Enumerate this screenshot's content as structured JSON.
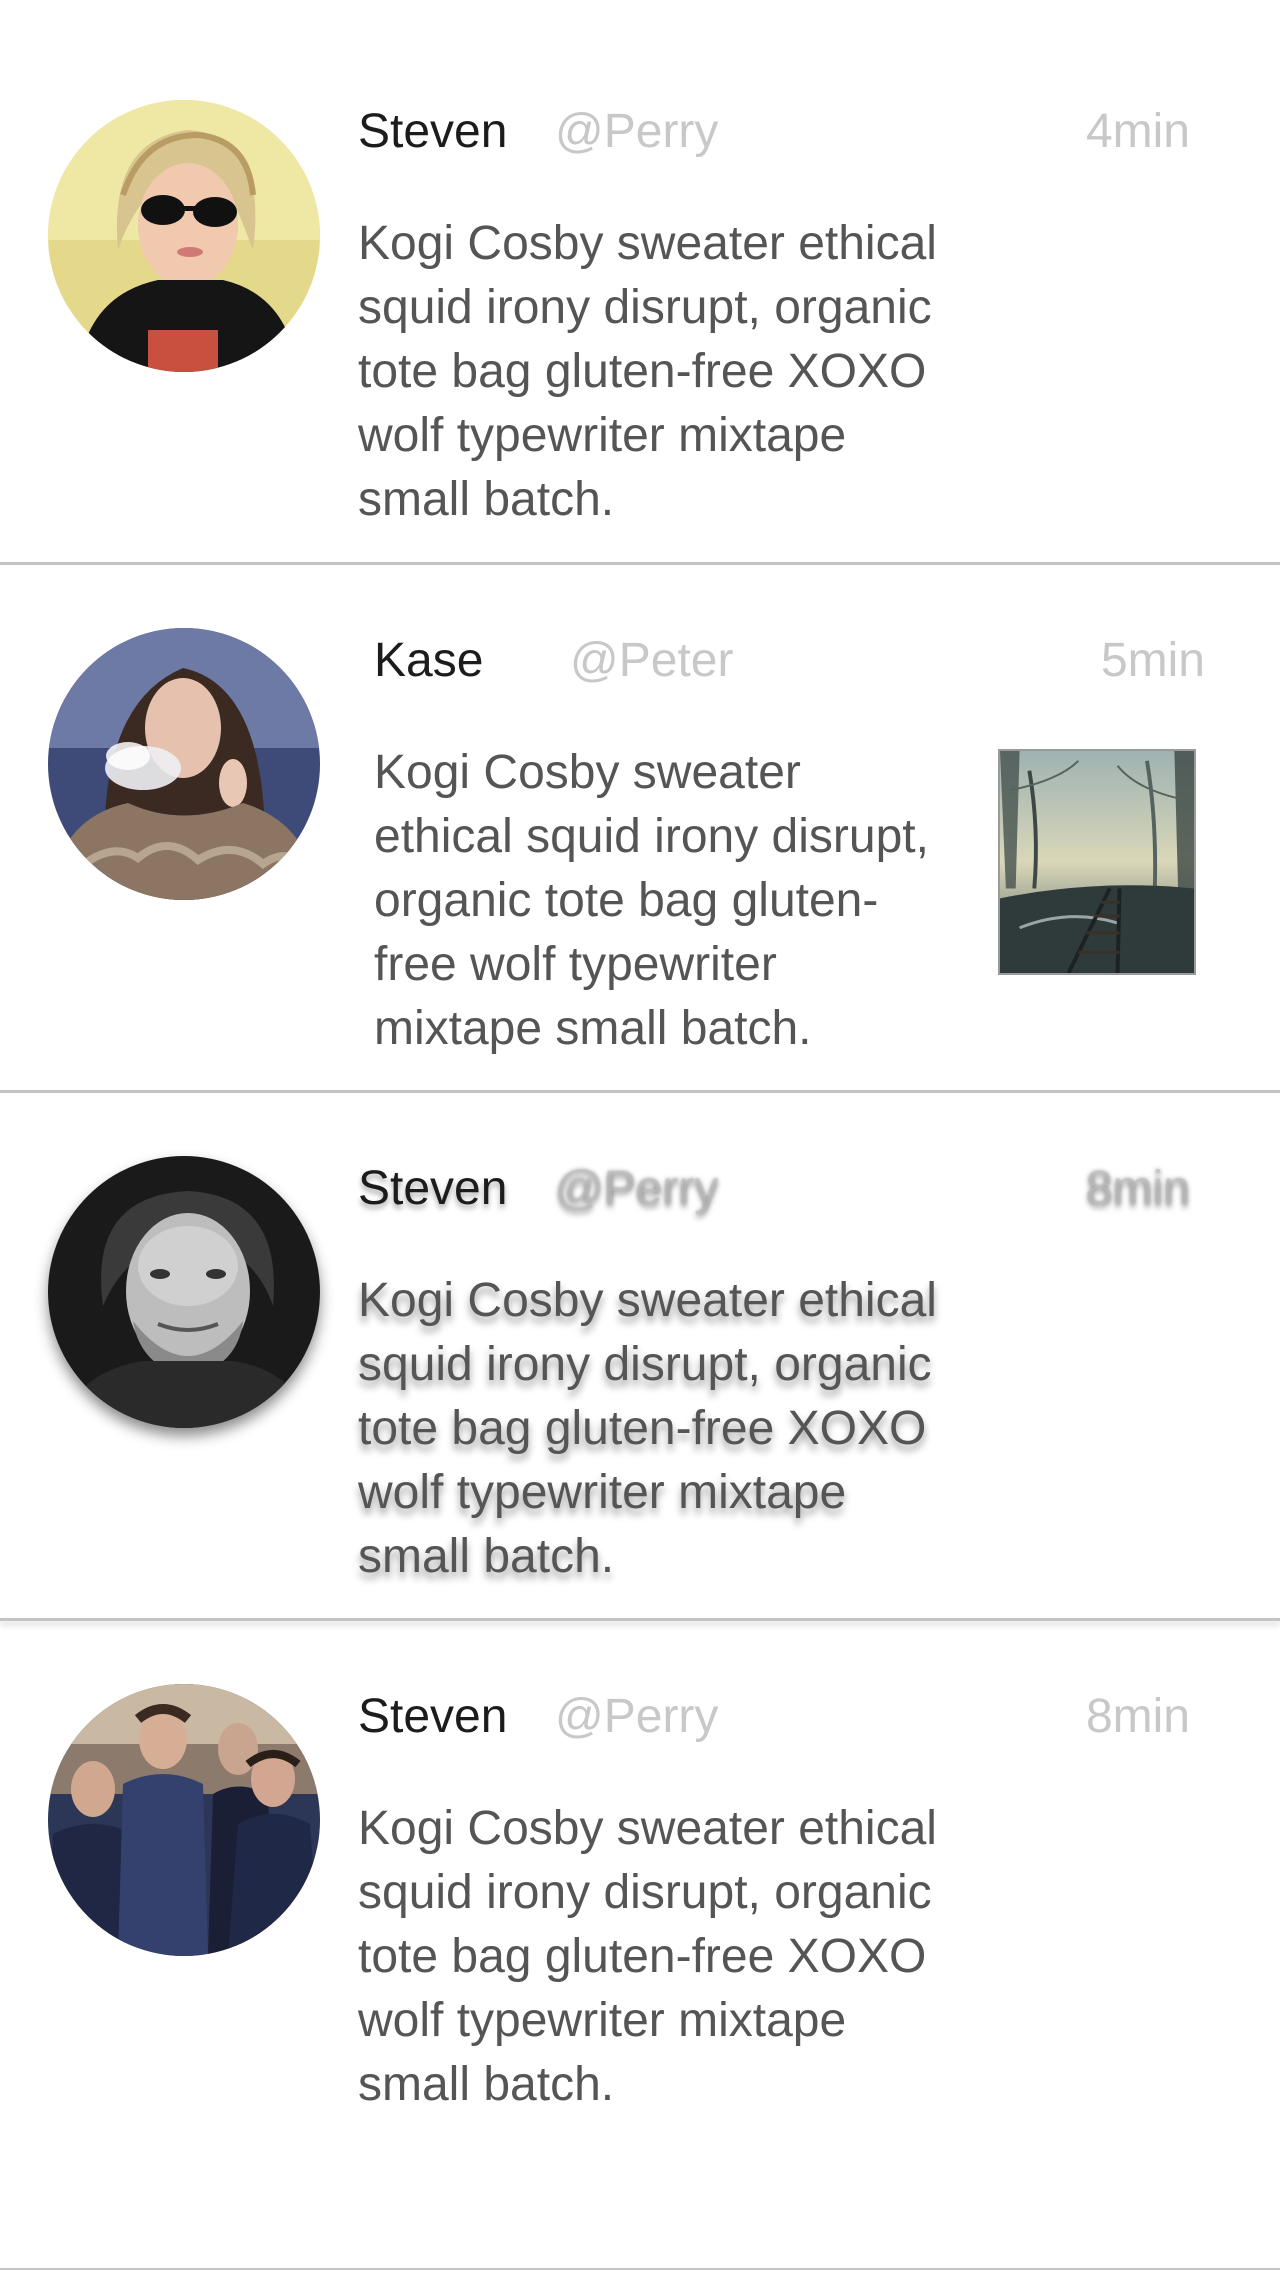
{
  "feed": {
    "posts": [
      {
        "name": "Steven",
        "handle": "@Perry",
        "time": "4min",
        "text": "Kogi Cosby sweater ethical\nsquid irony disrupt, organic\ntote bag gluten-free XOXO\nwolf typewriter mixtape\nsmall batch.",
        "avatar_icon": "avatar-blonde-woman-sunglasses"
      },
      {
        "name": "Kase",
        "handle": "@Peter",
        "time": "5min",
        "text": "Kogi Cosby sweater\nethical squid irony disrupt,\norganic tote bag gluten-\nfree wolf typewriter\nmixtape small batch.",
        "avatar_icon": "avatar-woman-fur-coat-smoke",
        "attachment_icon": "foggy-railway-photo"
      },
      {
        "name": "Steven",
        "handle": "@Perry",
        "time": "8min",
        "text": "Kogi Cosby sweater ethical\nsquid irony disrupt, organic\ntote bag gluten-free XOXO\nwolf typewriter mixtape\nsmall batch.",
        "avatar_icon": "avatar-bearded-man-bw"
      },
      {
        "name": "Steven",
        "handle": "@Perry",
        "time": "8min",
        "text": "Kogi Cosby sweater ethical\nsquid irony disrupt, organic\ntote bag gluten-free XOXO\nwolf typewriter mixtape\nsmall batch.",
        "avatar_icon": "avatar-band-group-denim"
      }
    ]
  },
  "colors": {
    "background": "#ffffff",
    "name": "#1c1c1c",
    "meta": "#c8c8c8",
    "body": "#555555",
    "divider": "#c4c4c4"
  }
}
